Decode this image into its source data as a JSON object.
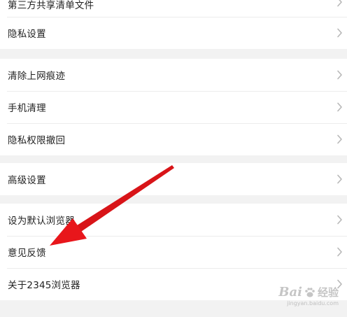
{
  "settings": {
    "group1": [
      {
        "label": "第三方共享清单文件"
      },
      {
        "label": "隐私设置"
      }
    ],
    "group2": [
      {
        "label": "清除上网痕迹"
      },
      {
        "label": "手机清理"
      },
      {
        "label": "隐私权限撤回"
      }
    ],
    "group3": [
      {
        "label": "高级设置"
      }
    ],
    "group4": [
      {
        "label": "设为默认浏览器"
      },
      {
        "label": "意见反馈"
      },
      {
        "label": "关于2345浏览器"
      }
    ]
  },
  "icons": {
    "row_chevron": "chevron-right-icon"
  },
  "colors": {
    "background": "#f2f2f2",
    "row_background": "#ffffff",
    "text": "#222222",
    "chevron": "#b8b8b8",
    "annotation_arrow": "#e8161b"
  },
  "watermark": {
    "brand": "Bai",
    "brand_suffix": "经验",
    "url": "jingyan.baidu.com"
  }
}
